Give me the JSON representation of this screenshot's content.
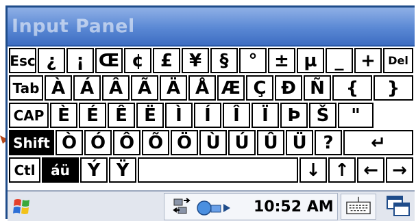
{
  "window": {
    "title": "Input Panel"
  },
  "keyboard": {
    "row1": [
      "Esc",
      "¿",
      "¡",
      "Œ",
      "¢",
      "£",
      "¥",
      "§",
      "°",
      "±",
      "µ",
      "_",
      "+",
      "Del"
    ],
    "row2": [
      "Tab",
      "À",
      "Á",
      "Â",
      "Ã",
      "Ä",
      "Å",
      "Æ",
      "Ç",
      "Ð",
      "Ñ",
      "{",
      "}"
    ],
    "row3": [
      "CAP",
      "È",
      "É",
      "Ê",
      "Ë",
      "Ì",
      "Í",
      "Î",
      "Ï",
      "Þ",
      "Š",
      "\""
    ],
    "row4": [
      "Shift",
      "Ò",
      "Ó",
      "Ô",
      "Õ",
      "Ö",
      "Ù",
      "Ú",
      "Û",
      "Ü",
      "?",
      "↵"
    ],
    "row5": [
      "Ctl",
      "áü",
      "Ý",
      "Ÿ",
      "",
      "↓",
      "↑",
      "←",
      "→"
    ]
  },
  "taskbar": {
    "time": "10:52 AM",
    "icons": [
      "windows-start-icon",
      "network-connection-icon",
      "sync-icon",
      "keyboard-icon",
      "windows-switch-icon"
    ]
  },
  "colors": {
    "titlebar": "#5a88d4",
    "frame": "#1f4c8a",
    "key_border": "#000000",
    "taskbar": "#e2e6ee"
  }
}
